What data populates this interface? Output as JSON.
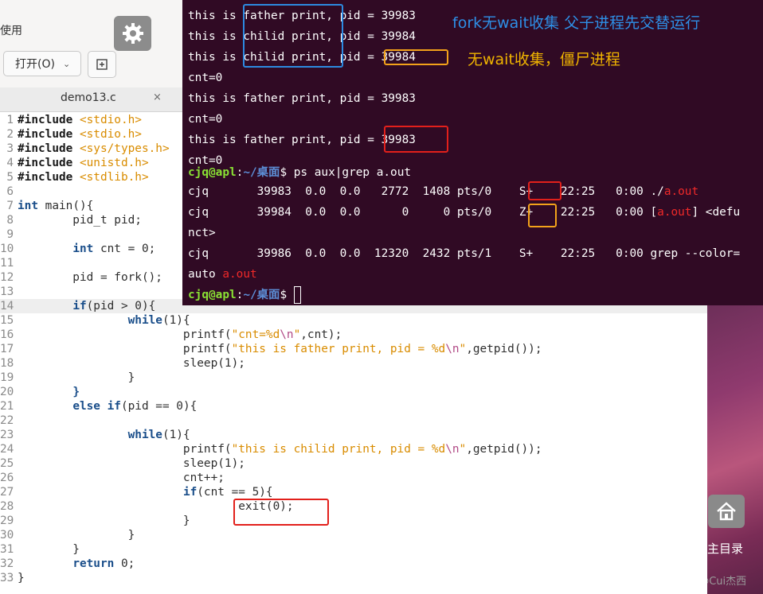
{
  "desktop": {
    "home_label": "主目录",
    "watermark": "CSDN @Cui杰西"
  },
  "editor": {
    "partial_label": "使用",
    "open_button": "打开(O)",
    "tab_title": "demo13.c",
    "tab_close": "×",
    "lines": [
      {
        "n": "1",
        "parts": [
          [
            "pp",
            "#include "
          ],
          [
            "hdr",
            "<stdio.h>"
          ]
        ]
      },
      {
        "n": "2",
        "parts": [
          [
            "pp",
            "#include "
          ],
          [
            "hdr",
            "<stdio.h>"
          ]
        ]
      },
      {
        "n": "3",
        "parts": [
          [
            "pp",
            "#include "
          ],
          [
            "hdr",
            "<sys/types.h>"
          ]
        ]
      },
      {
        "n": "4",
        "parts": [
          [
            "pp",
            "#include "
          ],
          [
            "hdr",
            "<unistd.h>"
          ]
        ]
      },
      {
        "n": "5",
        "parts": [
          [
            "pp",
            "#include "
          ],
          [
            "hdr",
            "<stdlib.h>"
          ]
        ]
      },
      {
        "n": "6",
        "parts": []
      },
      {
        "n": "7",
        "parts": [
          [
            "kw",
            "int"
          ],
          [
            "t",
            " main(){"
          ]
        ]
      },
      {
        "n": "8",
        "parts": [
          [
            "t",
            "        pid_t pid;"
          ]
        ]
      },
      {
        "n": "9",
        "parts": []
      },
      {
        "n": "10",
        "parts": [
          [
            "t",
            "        "
          ],
          [
            "kw",
            "int"
          ],
          [
            "t",
            " cnt = 0;"
          ]
        ]
      },
      {
        "n": "11",
        "parts": []
      },
      {
        "n": "12",
        "parts": [
          [
            "t",
            "        pid = fork();"
          ]
        ]
      },
      {
        "n": "13",
        "parts": []
      },
      {
        "n": "14",
        "parts": [
          [
            "t",
            "        "
          ],
          [
            "kw",
            "if"
          ],
          [
            "t",
            "(pid > 0){"
          ]
        ],
        "current": true
      },
      {
        "n": "15",
        "parts": [
          [
            "t",
            "                "
          ],
          [
            "kw",
            "while"
          ],
          [
            "t",
            "(1){"
          ]
        ]
      },
      {
        "n": "16",
        "parts": [
          [
            "t",
            "                        printf("
          ],
          [
            "str",
            "\"cnt=%d"
          ],
          [
            "esc",
            "\\n"
          ],
          [
            "str",
            "\""
          ],
          [
            "t",
            ",cnt);"
          ]
        ]
      },
      {
        "n": "17",
        "parts": [
          [
            "t",
            "                        printf("
          ],
          [
            "str",
            "\"this is father print, pid = %d"
          ],
          [
            "esc",
            "\\n"
          ],
          [
            "str",
            "\""
          ],
          [
            "t",
            ",getpid());"
          ]
        ]
      },
      {
        "n": "18",
        "parts": [
          [
            "t",
            "                        sleep(1);"
          ]
        ]
      },
      {
        "n": "19",
        "parts": [
          [
            "t",
            "                }"
          ]
        ]
      },
      {
        "n": "20",
        "parts": [
          [
            "t",
            "        "
          ],
          [
            "kw",
            "}"
          ]
        ]
      },
      {
        "n": "21",
        "parts": [
          [
            "t",
            "        "
          ],
          [
            "kw",
            "else if"
          ],
          [
            "t",
            "(pid == 0){"
          ]
        ]
      },
      {
        "n": "22",
        "parts": []
      },
      {
        "n": "23",
        "parts": [
          [
            "t",
            "                "
          ],
          [
            "kw",
            "while"
          ],
          [
            "t",
            "(1){"
          ]
        ]
      },
      {
        "n": "24",
        "parts": [
          [
            "t",
            "                        printf("
          ],
          [
            "str",
            "\"this is chilid print, pid = %d"
          ],
          [
            "esc",
            "\\n"
          ],
          [
            "str",
            "\""
          ],
          [
            "t",
            ",getpid());"
          ]
        ]
      },
      {
        "n": "25",
        "parts": [
          [
            "t",
            "                        sleep(1);"
          ]
        ]
      },
      {
        "n": "26",
        "parts": [
          [
            "t",
            "                        cnt++;"
          ]
        ]
      },
      {
        "n": "27",
        "parts": [
          [
            "t",
            "                        "
          ],
          [
            "kw",
            "if"
          ],
          [
            "t",
            "(cnt == 5){"
          ]
        ]
      },
      {
        "n": "28",
        "parts": [
          [
            "t",
            "                                exit(0);"
          ]
        ]
      },
      {
        "n": "29",
        "parts": [
          [
            "t",
            "                        }"
          ]
        ]
      },
      {
        "n": "30",
        "parts": [
          [
            "t",
            "                }"
          ]
        ]
      },
      {
        "n": "31",
        "parts": [
          [
            "t",
            "        }"
          ]
        ]
      },
      {
        "n": "32",
        "parts": [
          [
            "t",
            "        "
          ],
          [
            "kw",
            "return"
          ],
          [
            "t",
            " 0;"
          ]
        ]
      },
      {
        "n": "33",
        "parts": [
          [
            "t",
            "}"
          ]
        ]
      }
    ]
  },
  "terminal": {
    "annotation_blue": "fork无wait收集 父子进程先交替运行",
    "annotation_yellow": "无wait收集，僵尸进程",
    "output_lines": [
      "this is father print, pid = 39983",
      "this is chilid print, pid = 39984",
      "this is chilid print, pid = 39984",
      "cnt=0",
      "this is father print, pid = 39983",
      "cnt=0",
      "this is father print, pid = 39983",
      "cnt=0"
    ],
    "prompt_user": "cjq@apl",
    "prompt_path": "~/桌面",
    "prompt_symbol": "$",
    "command": " ps aux|grep a.out",
    "ps_rows": [
      {
        "user": "cjq",
        "pid": "39983",
        "cpu": "0.0",
        "mem": "0.0",
        "vsz": "2772",
        "rss": "1408",
        "tty": "pts/0",
        "stat": "S+",
        "start": "22:25",
        "time": "0:00",
        "cmd_prefix": "./",
        "cmd_hl": "a.out",
        "cmd_suffix": ""
      },
      {
        "user": "cjq",
        "pid": "39984",
        "cpu": "0.0",
        "mem": "0.0",
        "vsz": "0",
        "rss": "0",
        "tty": "pts/0",
        "stat": "Z+",
        "start": "22:25",
        "time": "0:00",
        "cmd_prefix": "[",
        "cmd_hl": "a.out",
        "cmd_suffix": "] <defu"
      },
      {
        "user": "cjq",
        "pid": "39986",
        "cpu": "0.0",
        "mem": "0.0",
        "vsz": "12320",
        "rss": "2432",
        "tty": "pts/1",
        "stat": "S+",
        "start": "22:25",
        "time": "0:00",
        "cmd_prefix": "grep --color=",
        "cmd_hl": "",
        "cmd_suffix": ""
      }
    ],
    "wrap_line_1": "nct>",
    "wrap_line_2_prefix": "auto ",
    "wrap_line_2_hl": "a.out"
  }
}
